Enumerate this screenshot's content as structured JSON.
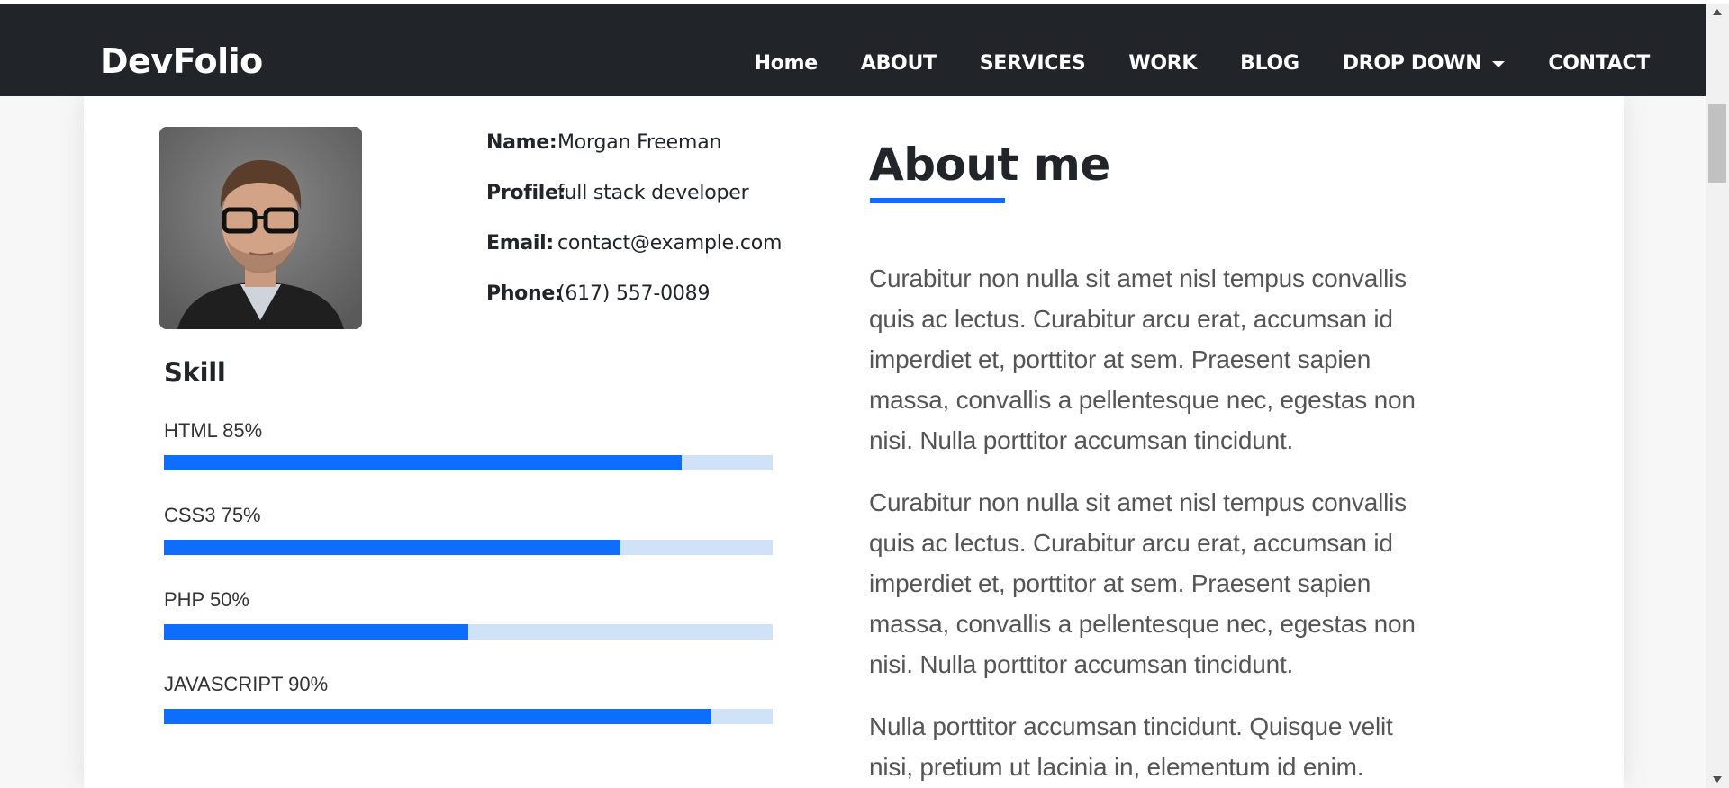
{
  "navbar": {
    "brand": "DevFolio",
    "items": [
      {
        "label": "Home"
      },
      {
        "label": "ABOUT"
      },
      {
        "label": "SERVICES"
      },
      {
        "label": "WORK"
      },
      {
        "label": "BLOG"
      },
      {
        "label": "DROP DOWN",
        "has_caret": true
      },
      {
        "label": "CONTACT"
      }
    ]
  },
  "profile": {
    "name_label": "Name:",
    "name": "Morgan Freeman",
    "profile_label": "Profile:",
    "profile": "full stack developer",
    "email_label": "Email:",
    "email": "contact@example.com",
    "phone_label": "Phone:",
    "phone": "(617) 557-0089"
  },
  "skills": {
    "title": "Skill",
    "items": [
      {
        "label": "HTML 85%",
        "value": 0.85
      },
      {
        "label": "CSS3 75%",
        "value": 0.75
      },
      {
        "label": "PHP 50%",
        "value": 0.5
      },
      {
        "label": "JAVASCRIPT 90%",
        "value": 0.9
      }
    ]
  },
  "about": {
    "title": "About me",
    "paragraphs": [
      "Curabitur non nulla sit amet nisl tempus convallis quis ac lectus. Curabitur arcu erat, accumsan id imperdiet et, porttitor at sem. Praesent sapien massa, convallis a pellentesque nec, egestas non nisi. Nulla porttitor accumsan tincidunt.",
      "Curabitur non nulla sit amet nisl tempus convallis quis ac lectus. Curabitur arcu erat, accumsan id imperdiet et, porttitor at sem. Praesent sapien massa, convallis a pellentesque nec, egestas non nisi. Nulla porttitor accumsan tincidunt.",
      "Nulla porttitor accumsan tincidunt. Quisque velit nisi, pretium ut lacinia in, elementum id enim."
    ]
  },
  "colors": {
    "navbar_bg": "#212529",
    "accent": "#0d6efd",
    "bar_track": "#cfe2f8"
  }
}
